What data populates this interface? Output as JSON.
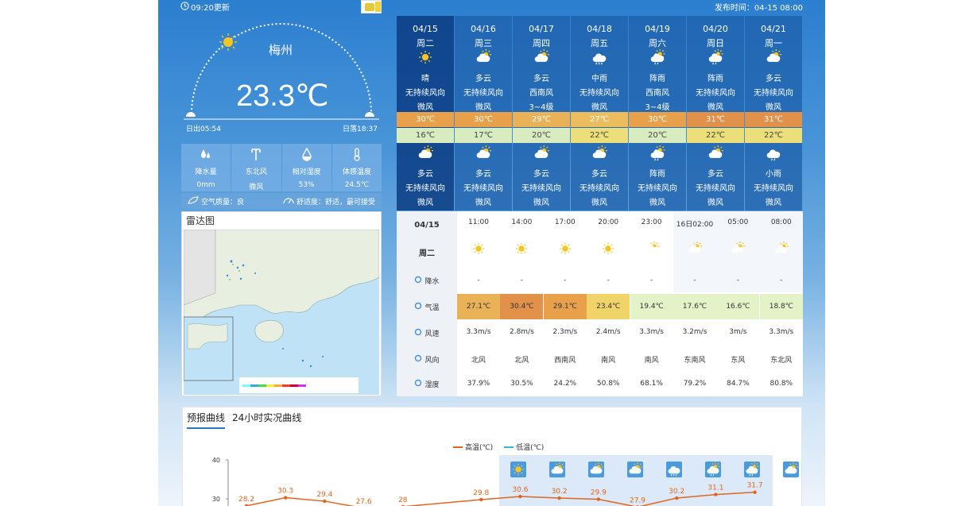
{
  "topbar": {
    "update_time": "09:20更新",
    "publish": "发布时间：04-15 08:00"
  },
  "current": {
    "city": "梅州",
    "temperature": "23.3℃",
    "sunrise": "日出05:54",
    "sunset": "日落18:37",
    "stats": [
      {
        "icon": "raindrops-icon",
        "label": "降水量",
        "value": "0mm"
      },
      {
        "icon": "wind-vane-icon",
        "label": "东北风",
        "value": "微风"
      },
      {
        "icon": "humidity-icon",
        "label": "相对湿度",
        "value": "53%"
      },
      {
        "icon": "thermometer-icon",
        "label": "体感温度",
        "value": "24.5℃"
      }
    ],
    "air_quality": "空气质量：良",
    "comfort": "舒适度：舒适，最可接受"
  },
  "radar": {
    "title": "雷达图"
  },
  "forecast_days": [
    {
      "date": "04/15",
      "weekday": "周二",
      "day_weather": "晴",
      "day_wind": "无持续风向",
      "day_wind_level": "微风",
      "high": "30℃",
      "low": "16℃",
      "night_weather": "多云",
      "night_wind": "无持续风向",
      "night_wind_level": "微风",
      "high_color": "#e8a14a",
      "low_color": "#d8ecc0",
      "day_icon": "sun-icon",
      "night_icon": "partly-cloudy-icon"
    },
    {
      "date": "04/16",
      "weekday": "周三",
      "day_weather": "多云",
      "day_wind": "无持续风向",
      "day_wind_level": "微风",
      "high": "30℃",
      "low": "17℃",
      "night_weather": "多云",
      "night_wind": "无持续风向",
      "night_wind_level": "微风",
      "high_color": "#e8a14a",
      "low_color": "#d8ecc0",
      "day_icon": "partly-cloudy-icon",
      "night_icon": "partly-cloudy-icon"
    },
    {
      "date": "04/17",
      "weekday": "周四",
      "day_weather": "多云",
      "day_wind": "西南风",
      "day_wind_level": "3~4级",
      "high": "29℃",
      "low": "20℃",
      "night_weather": "多云",
      "night_wind": "无持续风向",
      "night_wind_level": "微风",
      "high_color": "#eab257",
      "low_color": "#d8ecc0",
      "day_icon": "partly-cloudy-icon",
      "night_icon": "partly-cloudy-icon"
    },
    {
      "date": "04/18",
      "weekday": "周五",
      "day_weather": "中雨",
      "day_wind": "无持续风向",
      "day_wind_level": "微风",
      "high": "27℃",
      "low": "22℃",
      "night_weather": "多云",
      "night_wind": "无持续风向",
      "night_wind_level": "微风",
      "high_color": "#ecbd5e",
      "low_color": "#ecdf7a",
      "day_icon": "rain-icon",
      "night_icon": "partly-cloudy-icon"
    },
    {
      "date": "04/19",
      "weekday": "周六",
      "day_weather": "阵雨",
      "day_wind": "西南风",
      "day_wind_level": "3~4级",
      "high": "30℃",
      "low": "20℃",
      "night_weather": "阵雨",
      "night_wind": "无持续风向",
      "night_wind_level": "微风",
      "high_color": "#e8a14a",
      "low_color": "#d8ecc0",
      "day_icon": "shower-icon",
      "night_icon": "shower-icon"
    },
    {
      "date": "04/20",
      "weekday": "周日",
      "day_weather": "阵雨",
      "day_wind": "无持续风向",
      "day_wind_level": "微风",
      "high": "31℃",
      "low": "22℃",
      "night_weather": "多云",
      "night_wind": "无持续风向",
      "night_wind_level": "微风",
      "high_color": "#e2914a",
      "low_color": "#ecdf7a",
      "day_icon": "shower-icon",
      "night_icon": "partly-cloudy-icon"
    },
    {
      "date": "04/21",
      "weekday": "周一",
      "day_weather": "多云",
      "day_wind": "无持续风向",
      "day_wind_level": "微风",
      "high": "31℃",
      "low": "22℃",
      "night_weather": "小雨",
      "night_wind": "无持续风向",
      "night_wind_level": "微风",
      "high_color": "#e2914a",
      "low_color": "#ecdf7a",
      "day_icon": "partly-cloudy-icon",
      "night_icon": "light-rain-icon"
    }
  ],
  "hourly": {
    "date": "04/15",
    "weekday": "周二",
    "row_labels": {
      "rain": "降水",
      "temp": "气温",
      "wind_speed": "风速",
      "wind_dir": "风向",
      "humidity": "湿度"
    },
    "times": [
      "11:00",
      "14:00",
      "17:00",
      "20:00",
      "23:00",
      "16日02:00",
      "05:00",
      "08:00"
    ],
    "icons": [
      "sun-icon",
      "sun-icon",
      "sun-icon",
      "sun-icon",
      "partly-cloudy-icon",
      "partly-cloudy-icon",
      "partly-cloudy-icon",
      "partly-cloudy-icon"
    ],
    "rain": [
      "-",
      "-",
      "-",
      "-",
      "-",
      "-",
      "-",
      "-"
    ],
    "temps": [
      "27.1℃",
      "30.4℃",
      "29.1℃",
      "23.4℃",
      "19.4℃",
      "17.6℃",
      "16.6℃",
      "18.8℃"
    ],
    "temp_colors": [
      "#eab257",
      "#e2914a",
      "#e8a14a",
      "#f0d46a",
      "#e4f2c8",
      "#e4f2c8",
      "#e4f2c8",
      "#e4f2c8"
    ],
    "wind_speed": [
      "3.3m/s",
      "2.8m/s",
      "2.3m/s",
      "2.4m/s",
      "3.3m/s",
      "3.2m/s",
      "3m/s",
      "3.3m/s"
    ],
    "wind_dir": [
      "北风",
      "北风",
      "西南风",
      "南风",
      "南风",
      "东南风",
      "东风",
      "东北风"
    ],
    "humidity": [
      "37.9%",
      "30.5%",
      "24.2%",
      "50.8%",
      "68.1%",
      "79.2%",
      "84.7%",
      "80.8%"
    ]
  },
  "chart_tabs": [
    "预报曲线",
    "24小时实况曲线"
  ],
  "chart_data": {
    "type": "line",
    "series": [
      {
        "name": "高温(℃)",
        "values": [
          28.2,
          30.3,
          29.4,
          27.6,
          28,
          null,
          29.8,
          30.6,
          30.2,
          29.9,
          27.9,
          30.2,
          31.1,
          31.7
        ],
        "color": "#e0651e"
      },
      {
        "name": "低温(℃)",
        "values": [],
        "color": "#3cb6d8"
      }
    ],
    "y_ticks": [
      "40",
      "30"
    ],
    "ylim": [
      20,
      40
    ],
    "top_icons": [
      "sun-icon",
      "partly-cloudy-icon",
      "partly-cloudy-icon",
      "partly-cloudy-icon",
      "rain-icon",
      "shower-icon",
      "shower-icon",
      "partly-cloudy-icon"
    ]
  }
}
